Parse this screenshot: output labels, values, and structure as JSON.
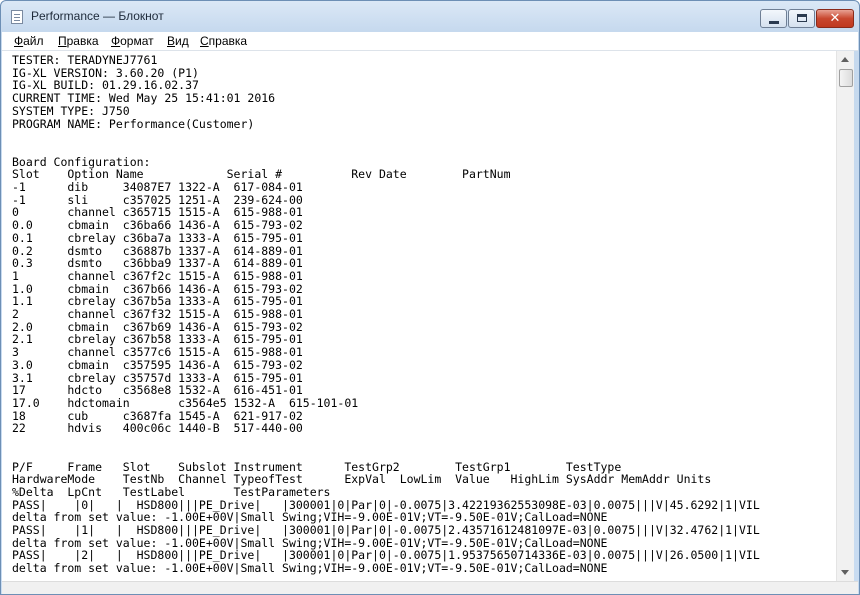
{
  "window": {
    "title": "Performance — Блокнот",
    "icon": "notepad-icon"
  },
  "menu": [
    "Файл",
    "Правка",
    "Формат",
    "Вид",
    "Справка"
  ],
  "document": {
    "lines": [
      "TESTER: TERADYNEJ7761",
      "IG-XL VERSION: 3.60.20 (P1)",
      "IG-XL BUILD: 01.29.16.02.37",
      "CURRENT TIME: Wed May 25 15:41:01 2016",
      "SYSTEM TYPE: J750",
      "PROGRAM NAME: Performance(Customer)",
      "",
      "",
      "Board Configuration:",
      "Slot    Option Name            Serial #          Rev Date        PartNum",
      "-1      dib     34087E7 1322-A  617-084-01",
      "-1      sli     c357025 1251-A  239-624-00",
      "0       channel c365715 1515-A  615-988-01",
      "0.0     cbmain  c36ba66 1436-A  615-793-02",
      "0.1     cbrelay c36ba7a 1333-A  615-795-01",
      "0.2     dsmto   c36887b 1337-A  614-889-01",
      "0.3     dsmto   c36bba9 1337-A  614-889-01",
      "1       channel c367f2c 1515-A  615-988-01",
      "1.0     cbmain  c367b66 1436-A  615-793-02",
      "1.1     cbrelay c367b5a 1333-A  615-795-01",
      "2       channel c367f32 1515-A  615-988-01",
      "2.0     cbmain  c367b69 1436-A  615-793-02",
      "2.1     cbrelay c367b58 1333-A  615-795-01",
      "3       channel c3577c6 1515-A  615-988-01",
      "3.0     cbmain  c357595 1436-A  615-793-02",
      "3.1     cbrelay c35757d 1333-A  615-795-01",
      "17      hdcto   c3568e8 1532-A  616-451-01",
      "17.0    hdctomain       c3564e5 1532-A  615-101-01",
      "18      cub     c3687fa 1545-A  621-917-02",
      "22      hdvis   400c06c 1440-B  517-440-00",
      "",
      "",
      "P/F     Frame   Slot    Subslot Instrument      TestGrp2        TestGrp1        TestType",
      "HardwareMode    TestNb  Channel TypeofTest      ExpVal  LowLim  Value   HighLim SysAddr MemAddr Units",
      "%Delta  LpCnt   TestLabel       TestParameters",
      "PASS|    |0|   |  HSD800|||PE_Drive|   |300001|0|Par|0|-0.0075|3.42219362553098E-03|0.0075|||V|45.6292|1|VIL",
      "delta from set value: -1.00E+00V|Small Swing;VIH=-9.00E-01V;VT=-9.50E-01V;CalLoad=NONE",
      "PASS|    |1|   |  HSD800|||PE_Drive|   |300001|0|Par|0|-0.0075|2.43571612481097E-03|0.0075|||V|32.4762|1|VIL",
      "delta from set value: -1.00E+00V|Small Swing;VIH=-9.00E-01V;VT=-9.50E-01V;CalLoad=NONE",
      "PASS|    |2|   |  HSD800|||PE_Drive|   |300001|0|Par|0|-0.0075|1.95375650714336E-03|0.0075|||V|26.0500|1|VIL",
      "delta from set value: -1.00E+00V|Small Swing;VIH=-9.00E-01V;VT=-9.50E-01V;CalLoad=NONE"
    ]
  }
}
